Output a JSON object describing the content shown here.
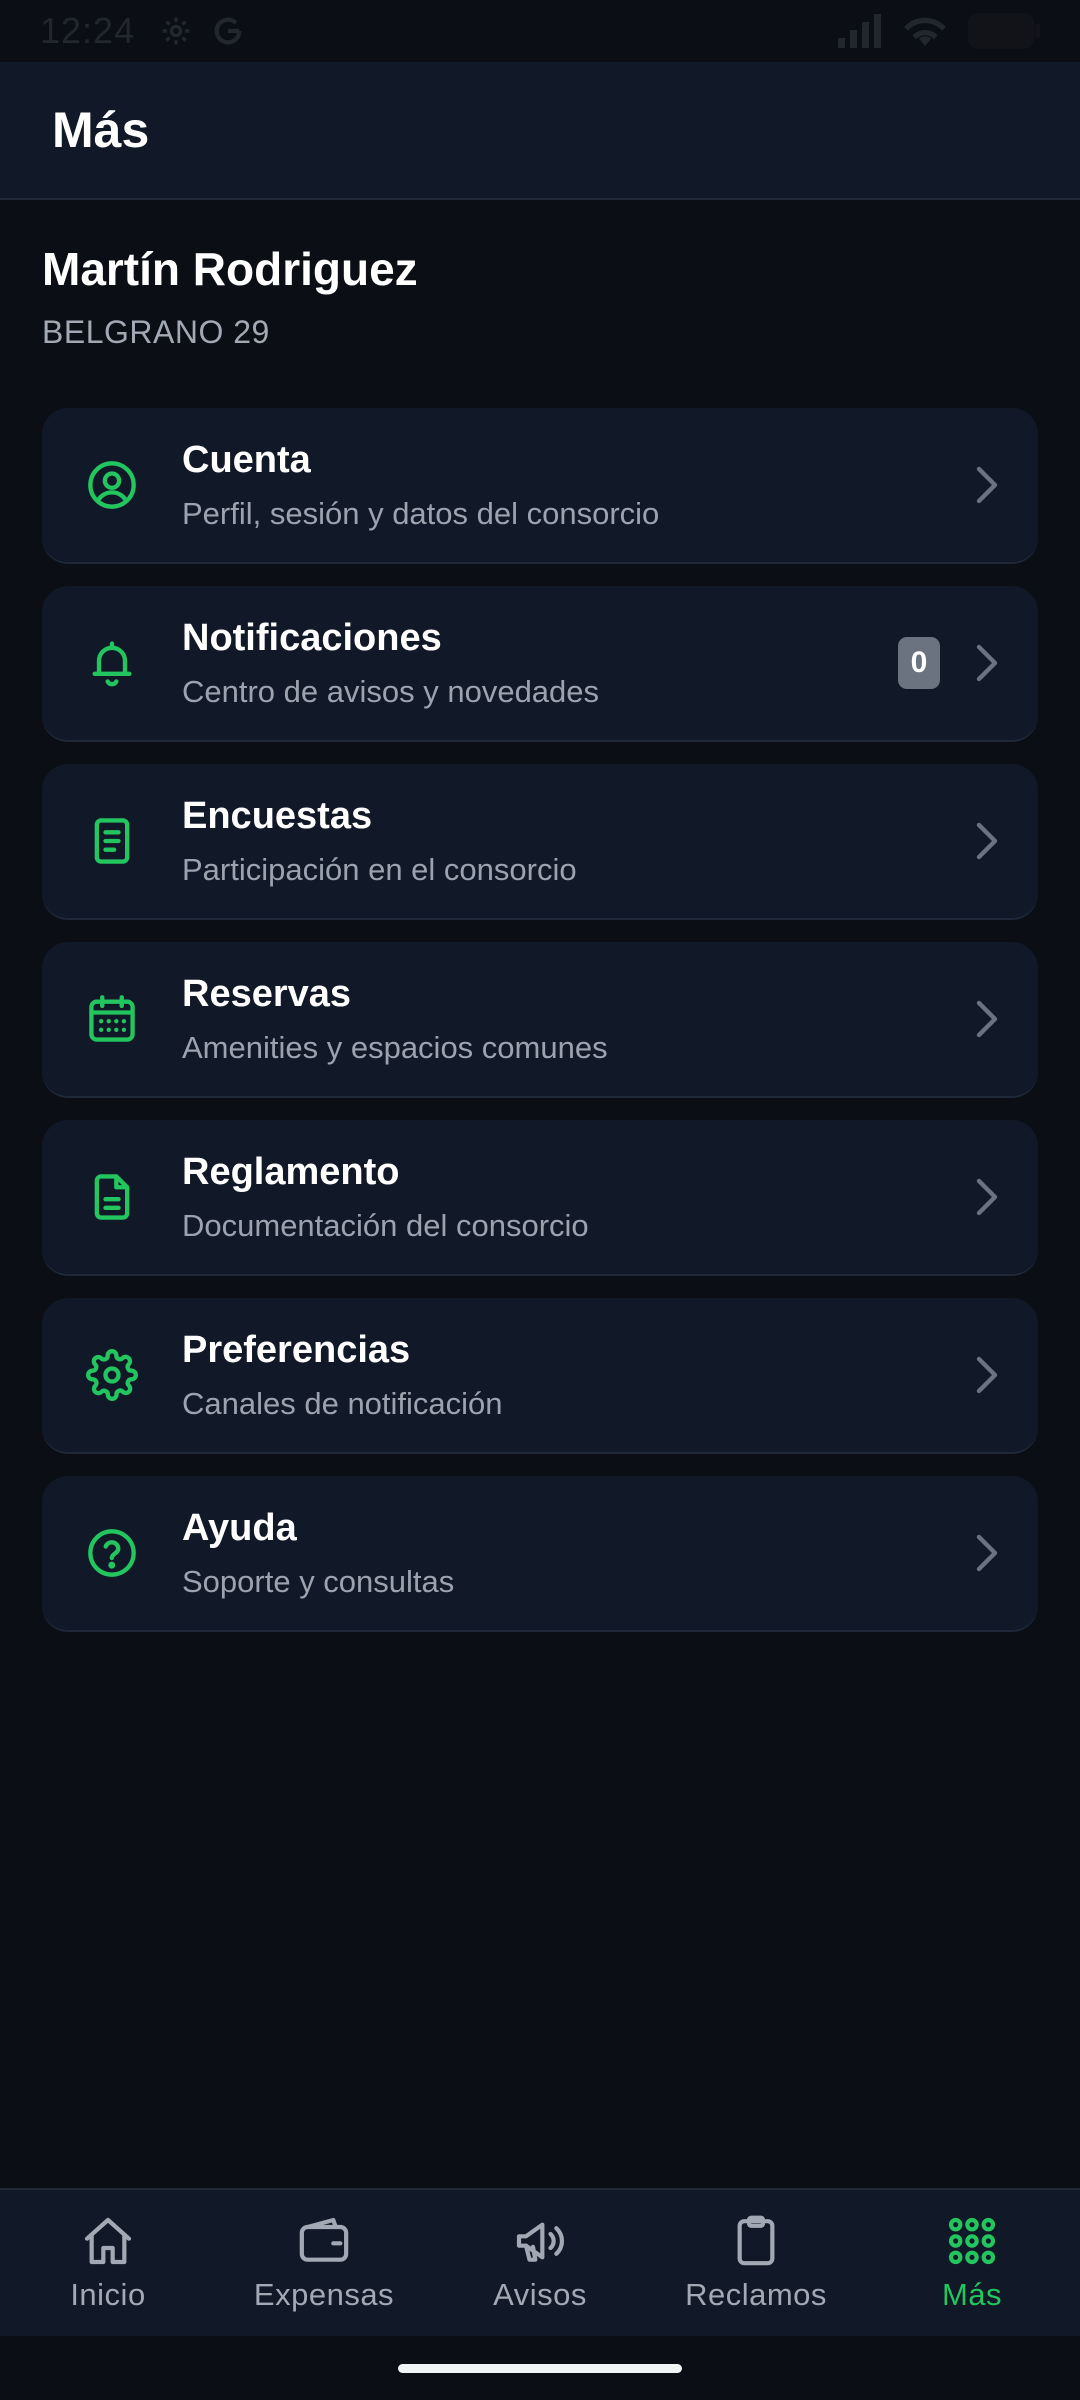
{
  "status_bar": {
    "time": "12:24",
    "icons_left": [
      "gear-icon",
      "google-icon"
    ],
    "icons_right": [
      "signal-icon",
      "wifi-icon",
      "battery-icon"
    ]
  },
  "header": {
    "title": "Más"
  },
  "user": {
    "name": "Martín Rodriguez",
    "unit": "BELGRANO 29"
  },
  "menu": {
    "items": [
      {
        "key": "cuenta",
        "icon": "user-circle-icon",
        "label": "Cuenta",
        "subtitle": "Perfil, sesión y datos del consorcio"
      },
      {
        "key": "notificaciones",
        "icon": "bell-icon",
        "label": "Notificaciones",
        "subtitle": "Centro de avisos y novedades",
        "badge": "0"
      },
      {
        "key": "encuestas",
        "icon": "survey-icon",
        "label": "Encuestas",
        "subtitle": "Participación en el consorcio"
      },
      {
        "key": "reservas",
        "icon": "calendar-icon",
        "label": "Reservas",
        "subtitle": "Amenities y espacios comunes"
      },
      {
        "key": "reglamento",
        "icon": "document-icon",
        "label": "Reglamento",
        "subtitle": "Documentación del consorcio"
      },
      {
        "key": "preferencias",
        "icon": "gear-icon",
        "label": "Preferencias",
        "subtitle": "Canales de notificación"
      },
      {
        "key": "ayuda",
        "icon": "help-circle-icon",
        "label": "Ayuda",
        "subtitle": "Soporte y consultas"
      }
    ]
  },
  "bottom_nav": {
    "items": [
      {
        "key": "inicio",
        "icon": "home-icon",
        "label": "Inicio",
        "active": false
      },
      {
        "key": "expensas",
        "icon": "wallet-icon",
        "label": "Expensas",
        "active": false
      },
      {
        "key": "avisos",
        "icon": "megaphone-icon",
        "label": "Avisos",
        "active": false
      },
      {
        "key": "reclamos",
        "icon": "clipboard-icon",
        "label": "Reclamos",
        "active": false
      },
      {
        "key": "mas",
        "icon": "grid-dots-icon",
        "label": "Más",
        "active": true
      }
    ]
  },
  "colors": {
    "accent": "#22c55e",
    "background": "#0b0e14",
    "card": "#111827",
    "muted_text": "#9ca3af",
    "badge": "#6b7280"
  }
}
